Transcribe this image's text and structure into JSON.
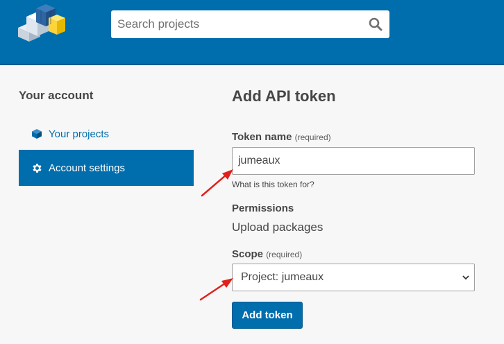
{
  "header": {
    "logo": "pypi-logo",
    "search": {
      "placeholder": "Search projects",
      "icon": "search-icon"
    }
  },
  "sidebar": {
    "title": "Your account",
    "items": [
      {
        "label": "Your projects",
        "icon": "cube-icon",
        "active": false
      },
      {
        "label": "Account settings",
        "icon": "gear-icon",
        "active": true
      }
    ]
  },
  "form": {
    "title": "Add API token",
    "token_name": {
      "label": "Token name",
      "required": "(required)",
      "value": "jumeaux",
      "help": "What is this token for?"
    },
    "permissions": {
      "label": "Permissions",
      "value": "Upload packages"
    },
    "scope": {
      "label": "Scope",
      "required": "(required)",
      "selected": "Project: jumeaux"
    },
    "submit_label": "Add token"
  },
  "colors": {
    "brand": "#006dad",
    "annotation": "#e0201b"
  }
}
